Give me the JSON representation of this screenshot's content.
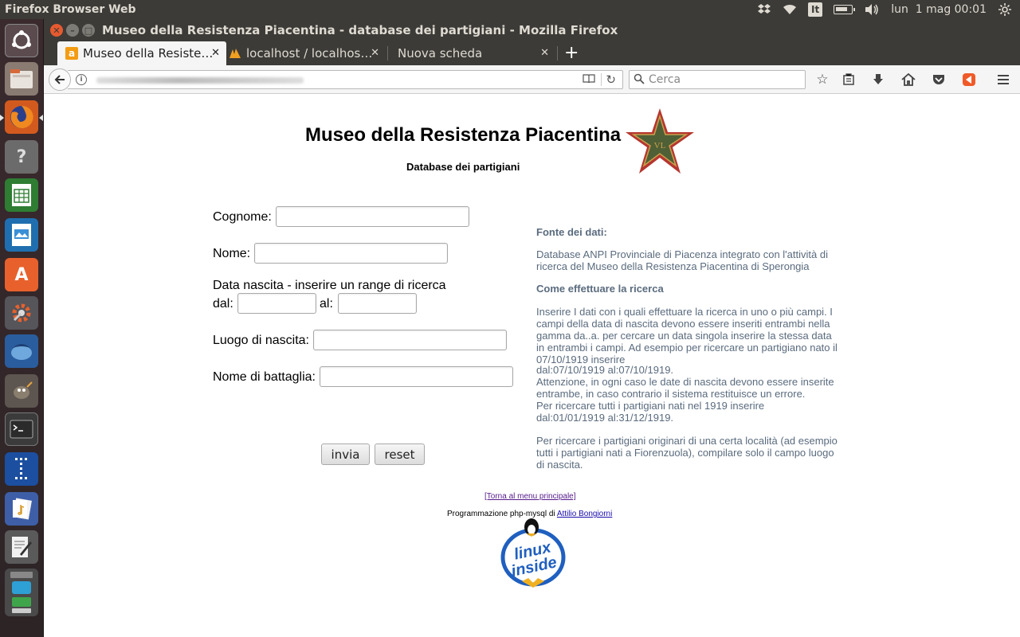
{
  "top_panel": {
    "app_name": "Firefox Browser Web",
    "keyboard_layout": "It",
    "clock": "lun  1 mag 00:01",
    "icons": [
      "dropbox-icon",
      "wifi-icon",
      "keyboard-layout-icon",
      "battery-icon",
      "volume-icon",
      "power-icon"
    ]
  },
  "launcher": {
    "items": [
      "ubuntu-dash",
      "file-manager",
      "firefox",
      "help",
      "libreoffice-calc",
      "libreoffice-impress",
      "ubuntu-software",
      "system-settings",
      "thunderbird",
      "gimp",
      "terminal",
      "app-unknown",
      "app-notes",
      "text-editor",
      "app-stack"
    ]
  },
  "window": {
    "title": "Museo della Resistenza Piacentina - database dei partigiani - Mozilla Firefox"
  },
  "tabs": [
    {
      "label": "Museo della Resiste…",
      "active": true
    },
    {
      "label": "localhost / localhos…",
      "active": false
    },
    {
      "label": "Nuova scheda",
      "active": false
    }
  ],
  "navbar": {
    "search_placeholder": "Cerca"
  },
  "page": {
    "title": "Museo della Resistenza Piacentina",
    "subtitle": "Database dei partigiani",
    "form": {
      "cognome_label": "Cognome:",
      "nome_label": "Nome:",
      "data_label": "Data nascita - inserire un range di ricerca",
      "dal_label": "dal:",
      "al_label": "al:",
      "luogo_label": "Luogo di nascita:",
      "battaglia_label": "Nome di battaglia:",
      "submit_label": "invia",
      "reset_label": "reset"
    },
    "info": {
      "fonte_heading": "Fonte dei dati:",
      "fonte_text": "Database ANPI Provinciale di Piacenza integrato con l'attività di ricerca del Museo della Resistenza Piacentina di Sperongia",
      "come_heading": "Come effettuare la ricerca",
      "p1": "Inserire I dati con i quali effettuare la ricerca in uno o più campi. I campi della data di nascita devono essere inseriti entrambi nella gamma da..a. per cercare un data singola inserire la stessa data in entrambi i campi. Ad esempio per ricercare un partigiano nato il 07/10/1919 inserire",
      "p1b": "dal:07/10/1919 al:07/10/1919.",
      "p2": "Attenzione, in ogni caso le date di nascita devono essere inserite entrambe, in caso contrario il sistema restituisce un errore.",
      "p3": "Per ricercare tutti i partigiani nati nel 1919 inserire",
      "p3b": "dal:01/01/1919 al:31/12/1919.",
      "p4": "Per ricercare i partigiani originari di una certa località (ad esempio tutti i partigiani nati a Fiorenzuola), compilare solo il campo luogo di nascita."
    },
    "footer": {
      "menu_link": "[Torna al menu principale]",
      "credit_prefix": "Programmazione php-mysql di",
      "credit_author": "Attilio Bongiorni",
      "logo_text_1": "linux",
      "logo_text_2": "inside"
    }
  }
}
